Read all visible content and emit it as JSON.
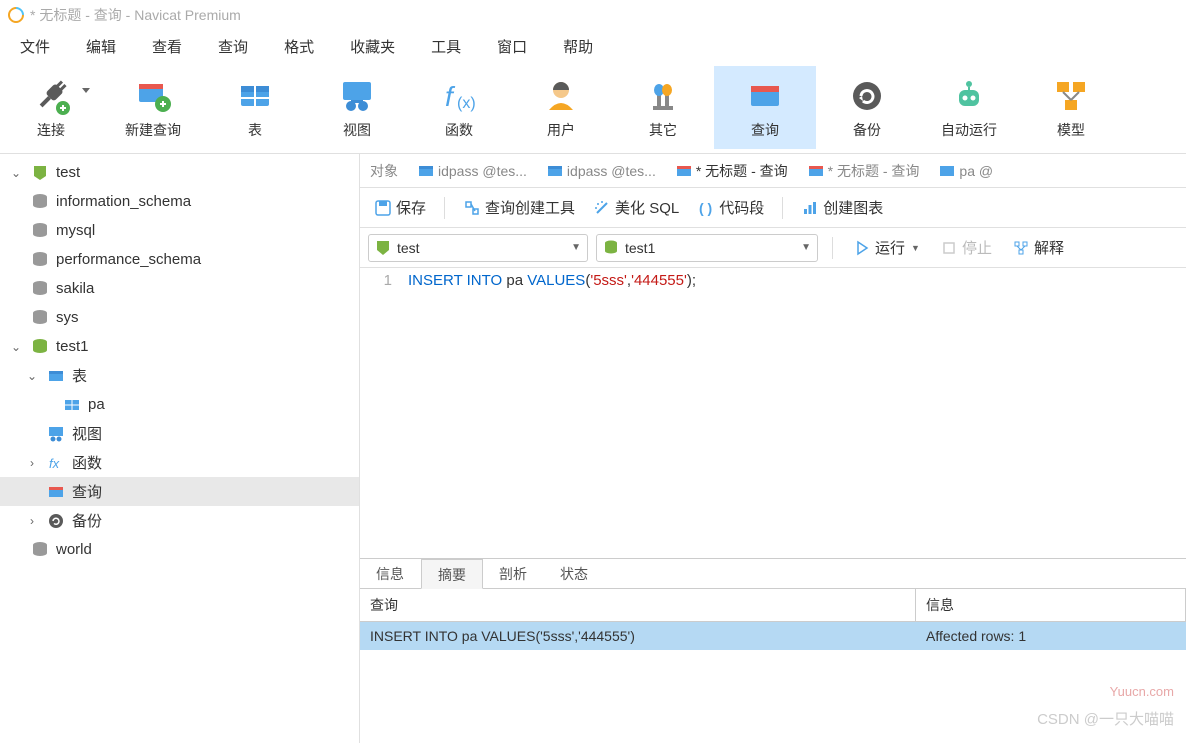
{
  "titlebar": {
    "title": "* 无标题 - 查询 - Navicat Premium"
  },
  "menubar": [
    "文件",
    "编辑",
    "查看",
    "查询",
    "格式",
    "收藏夹",
    "工具",
    "窗口",
    "帮助"
  ],
  "toolbar": [
    {
      "label": "连接",
      "icon": "plug",
      "dropdown": true
    },
    {
      "label": "新建查询",
      "icon": "new-query"
    },
    {
      "label": "表",
      "icon": "table"
    },
    {
      "label": "视图",
      "icon": "view"
    },
    {
      "label": "函数",
      "icon": "fx"
    },
    {
      "label": "用户",
      "icon": "user"
    },
    {
      "label": "其它",
      "icon": "other"
    },
    {
      "label": "查询",
      "icon": "query",
      "active": true
    },
    {
      "label": "备份",
      "icon": "backup"
    },
    {
      "label": "自动运行",
      "icon": "auto"
    },
    {
      "label": "模型",
      "icon": "model"
    }
  ],
  "tree": {
    "root": "test",
    "items": [
      {
        "label": "information_schema",
        "icon": "db-gray",
        "level": 1
      },
      {
        "label": "mysql",
        "icon": "db-gray",
        "level": 1
      },
      {
        "label": "performance_schema",
        "icon": "db-gray",
        "level": 1
      },
      {
        "label": "sakila",
        "icon": "db-gray",
        "level": 1
      },
      {
        "label": "sys",
        "icon": "db-gray",
        "level": 1
      }
    ],
    "openDb": "test1",
    "openChildren": {
      "tables": "表",
      "table_pa": "pa",
      "views": "视图",
      "functions": "函数",
      "queries": "查询",
      "backups": "备份"
    },
    "world": "world"
  },
  "tabs": [
    {
      "label": "对象",
      "icon": null
    },
    {
      "label": "idpass @tes...",
      "icon": "q-blue"
    },
    {
      "label": "idpass @tes...",
      "icon": "q-blue"
    },
    {
      "label": "* 无标题 - 查询",
      "icon": "q-orange"
    },
    {
      "label": "* 无标题 - 查询",
      "icon": "q-orange"
    },
    {
      "label": "pa @",
      "icon": "t-blue"
    }
  ],
  "subtoolbar": {
    "save": "保存",
    "queryBuilder": "查询创建工具",
    "beautify": "美化 SQL",
    "snippets": "代码段",
    "chart": "创建图表"
  },
  "connRow": {
    "conn": "test",
    "db": "test1",
    "run": "运行",
    "stop": "停止",
    "explain": "解释"
  },
  "editor": {
    "lineNum": "1",
    "sql_k1": "INSERT",
    "sql_k2": "INTO",
    "sql_tbl": "pa",
    "sql_k3": "VALUES",
    "sql_p1": "(",
    "sql_s1": "'5sss'",
    "sql_c": ",",
    "sql_s2": "'444555'",
    "sql_p2": ");"
  },
  "resultTabs": [
    "信息",
    "摘要",
    "剖析",
    "状态"
  ],
  "resultActiveTab": 1,
  "resultTable": {
    "headers": {
      "query": "查询",
      "info": "信息"
    },
    "row": {
      "query": "INSERT INTO pa VALUES('5sss','444555')",
      "info": "Affected rows: 1"
    }
  },
  "watermark1": "Yuucn.com",
  "watermark2": "CSDN @一只大喵喵"
}
